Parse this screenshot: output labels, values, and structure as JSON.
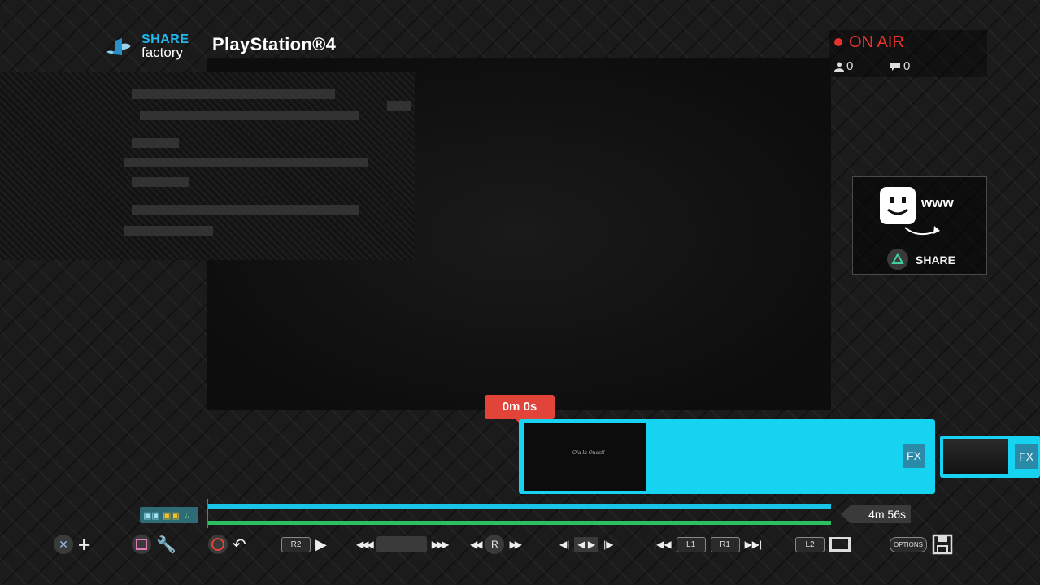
{
  "header": {
    "logo_share": "SHARE",
    "logo_factory": "factory",
    "platform": "PlayStation®4"
  },
  "broadcast": {
    "status": "ON AIR",
    "viewers": "0",
    "comments": "0",
    "status_color": "#e8322b"
  },
  "share_panel": {
    "www": "www",
    "label": "SHARE"
  },
  "timeline": {
    "current_time": "0m 0s",
    "total_duration": "4m 56s",
    "clip_caption": "Ola la Ouest!",
    "fx_label": "FX",
    "progress_fraction": 0.0,
    "clip_color": "#17d3f2",
    "audio_track_color": "#2fbf63"
  },
  "controls": {
    "r2": "R2",
    "r": "R",
    "l1": "L1",
    "r1": "R1",
    "l2": "L2",
    "options": "OPTIONS"
  }
}
